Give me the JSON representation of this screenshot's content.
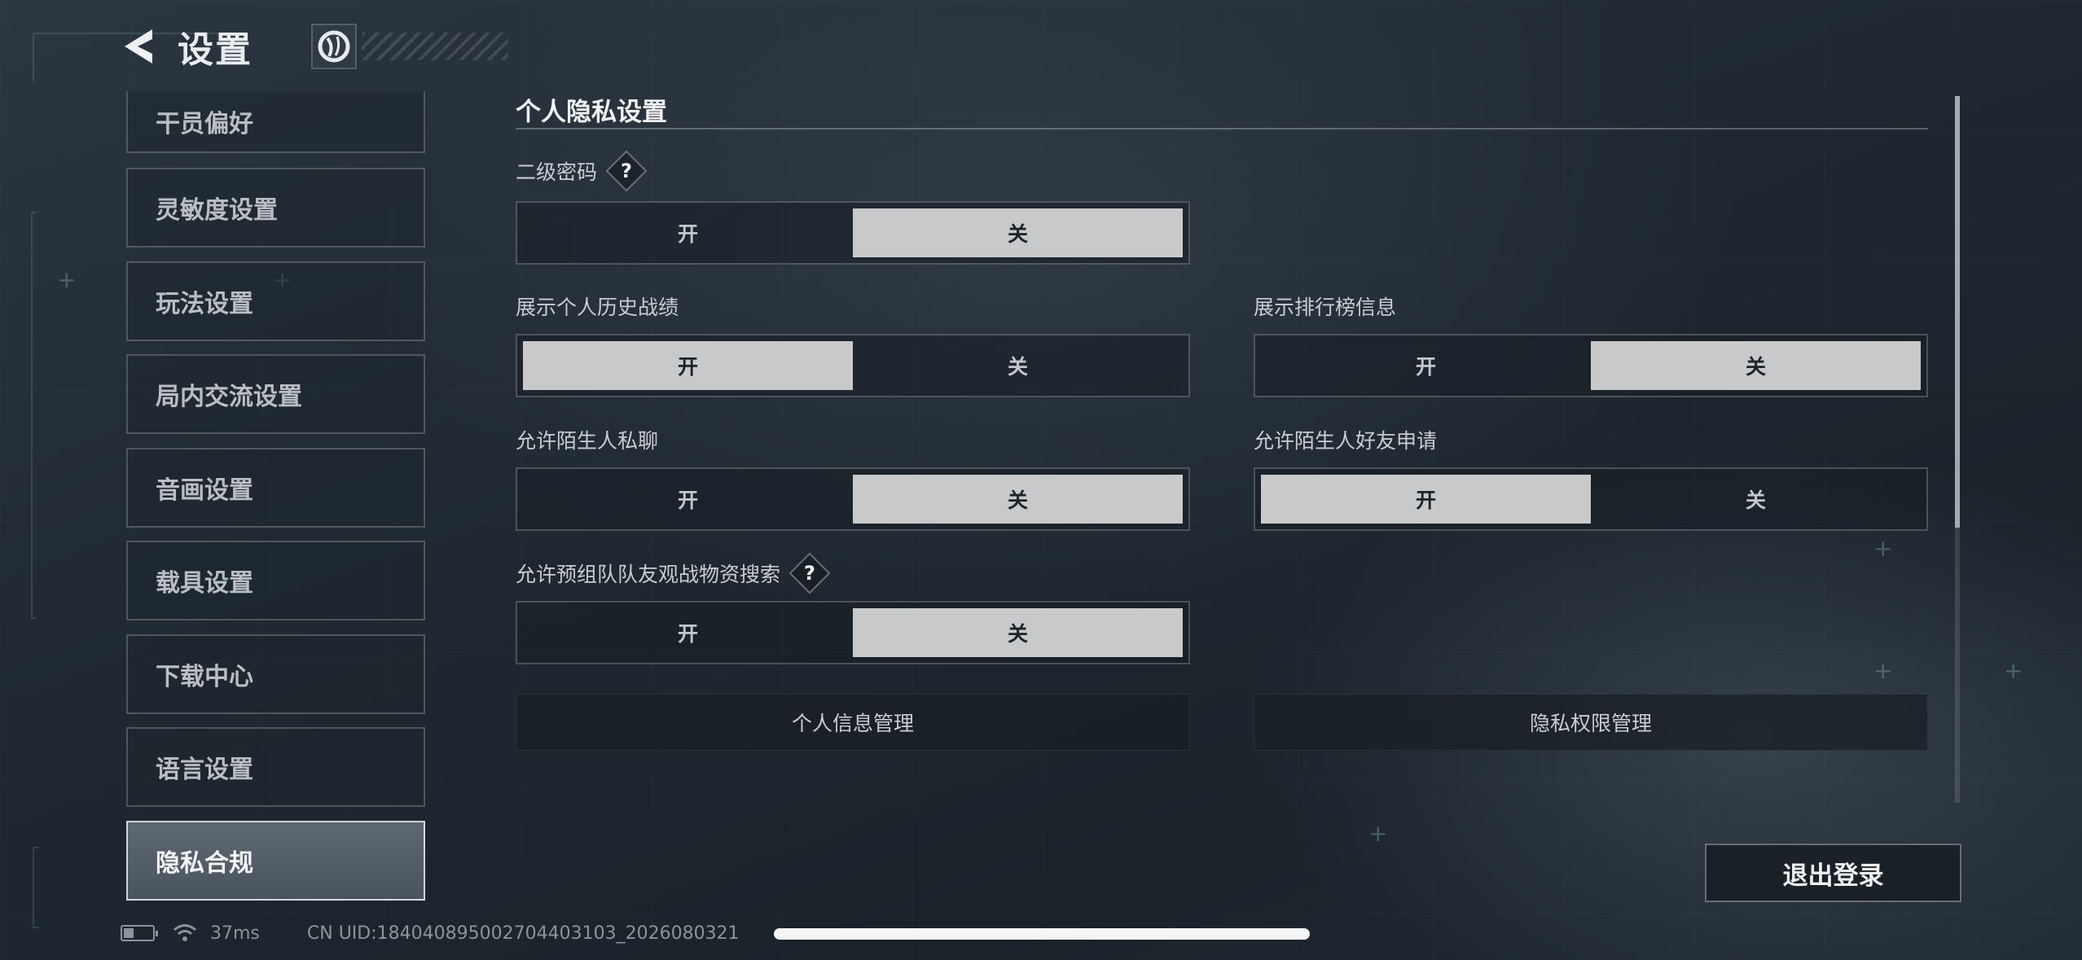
{
  "header": {
    "title": "设置"
  },
  "sidebar": {
    "items": [
      {
        "label": "干员偏好"
      },
      {
        "label": "灵敏度设置"
      },
      {
        "label": "玩法设置"
      },
      {
        "label": "局内交流设置"
      },
      {
        "label": "音画设置"
      },
      {
        "label": "载具设置"
      },
      {
        "label": "下载中心"
      },
      {
        "label": "语言设置"
      },
      {
        "label": "隐私合规",
        "active": true
      }
    ]
  },
  "main": {
    "section_title": "个人隐私设置",
    "on_label": "开",
    "off_label": "关",
    "settings": [
      {
        "label": "二级密码",
        "has_help": true,
        "selected": "off"
      },
      {
        "label": "展示个人历史战绩",
        "selected": "on"
      },
      {
        "label": "展示排行榜信息",
        "selected": "off"
      },
      {
        "label": "允许陌生人私聊",
        "selected": "off"
      },
      {
        "label": "允许陌生人好友申请",
        "selected": "on"
      },
      {
        "label": "允许预组队队友观战物资搜索",
        "has_help": true,
        "selected": "off"
      }
    ],
    "help_symbol": "?",
    "buttons": {
      "personal_info": "个人信息管理",
      "privacy_permissions": "隐私权限管理"
    },
    "logout": "退出登录"
  },
  "status": {
    "ping": "37ms",
    "uid": "CN UID:18404089500270440310З_2026080321",
    "uid_clean": "CN UID:184040895002704403103_2026080321"
  },
  "colors": {
    "selected_bg": "#c8c9ca",
    "active_sidebar": "#4a545e",
    "background": "#1f2831"
  }
}
